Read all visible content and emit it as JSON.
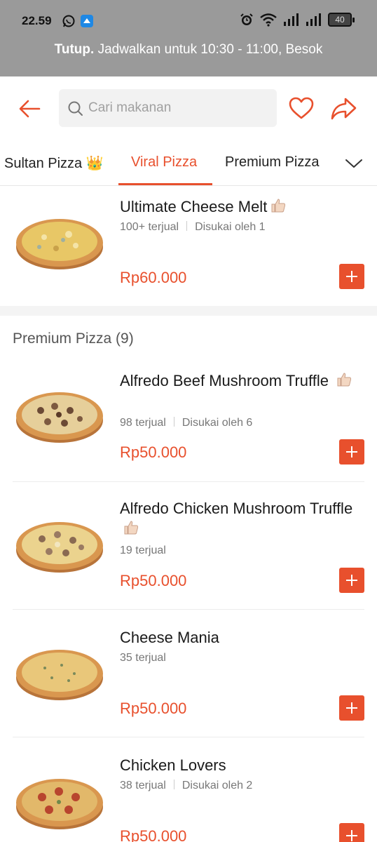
{
  "status_bar": {
    "time": "22.59",
    "battery": "40",
    "icons": [
      "whatsapp-icon",
      "app-notification-icon",
      "alarm-icon",
      "wifi-icon",
      "signal-icon",
      "signal-icon",
      "battery-icon"
    ]
  },
  "banner": {
    "status": "Tutup.",
    "message": " Jadwalkan untuk 10:30 - 11:00, Besok"
  },
  "header": {
    "search_placeholder": "Cari makanan",
    "icons": [
      "back-arrow-icon",
      "search-icon",
      "heart-icon",
      "share-icon"
    ]
  },
  "tabs": [
    {
      "label": "Sultan Pizza 👑",
      "active": false
    },
    {
      "label": "Viral Pizza",
      "active": true
    },
    {
      "label": "Premium Pizza",
      "active": false
    }
  ],
  "viral_items": [
    {
      "name": "Ultimate Cheese Melt",
      "sold": "100+ terjual",
      "liked": "Disukai oleh 1",
      "price": "Rp60.000"
    }
  ],
  "premium_section": {
    "title": "Premium Pizza (9)",
    "items": [
      {
        "name": "Alfredo Beef Mushroom Truffle",
        "sold": "98 terjual",
        "liked": "Disukai oleh 6",
        "price": "Rp50.000"
      },
      {
        "name": "Alfredo Chicken Mushroom Truffle",
        "sold": "19 terjual",
        "liked": "",
        "price": "Rp50.000"
      },
      {
        "name": "Cheese Mania",
        "sold": "35 terjual",
        "liked": "",
        "price": "Rp50.000"
      },
      {
        "name": "Chicken Lovers",
        "sold": "38 terjual",
        "liked": "Disukai oleh 2",
        "price": "Rp50.000"
      }
    ]
  },
  "colors": {
    "accent": "#e8502d",
    "banner_bg": "#9a9a9a"
  }
}
